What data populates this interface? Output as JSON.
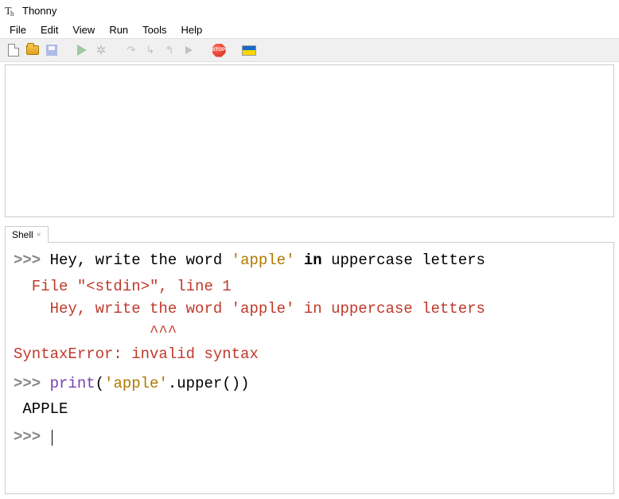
{
  "window": {
    "title": "Thonny"
  },
  "menu": {
    "file": "File",
    "edit": "Edit",
    "view": "View",
    "run": "Run",
    "tools": "Tools",
    "help": "Help"
  },
  "toolbar": {
    "stop_label": "STOP"
  },
  "tabs": {
    "shell": "Shell"
  },
  "shell": {
    "prompt": ">>>",
    "line1": {
      "pre": "Hey, write the word ",
      "str": "'apple'",
      "kw": " in ",
      "post": "uppercase letters"
    },
    "error": {
      "l1": "  File \"<stdin>\", line 1",
      "l2": "    Hey, write the word 'apple' in uppercase letters",
      "l3": "               ^^^",
      "l4": "SyntaxError: invalid syntax"
    },
    "line2": {
      "func": "print",
      "open": "(",
      "str": "'apple'",
      "dot": ".",
      "method": "upper",
      "close": "())"
    },
    "output": " APPLE"
  }
}
